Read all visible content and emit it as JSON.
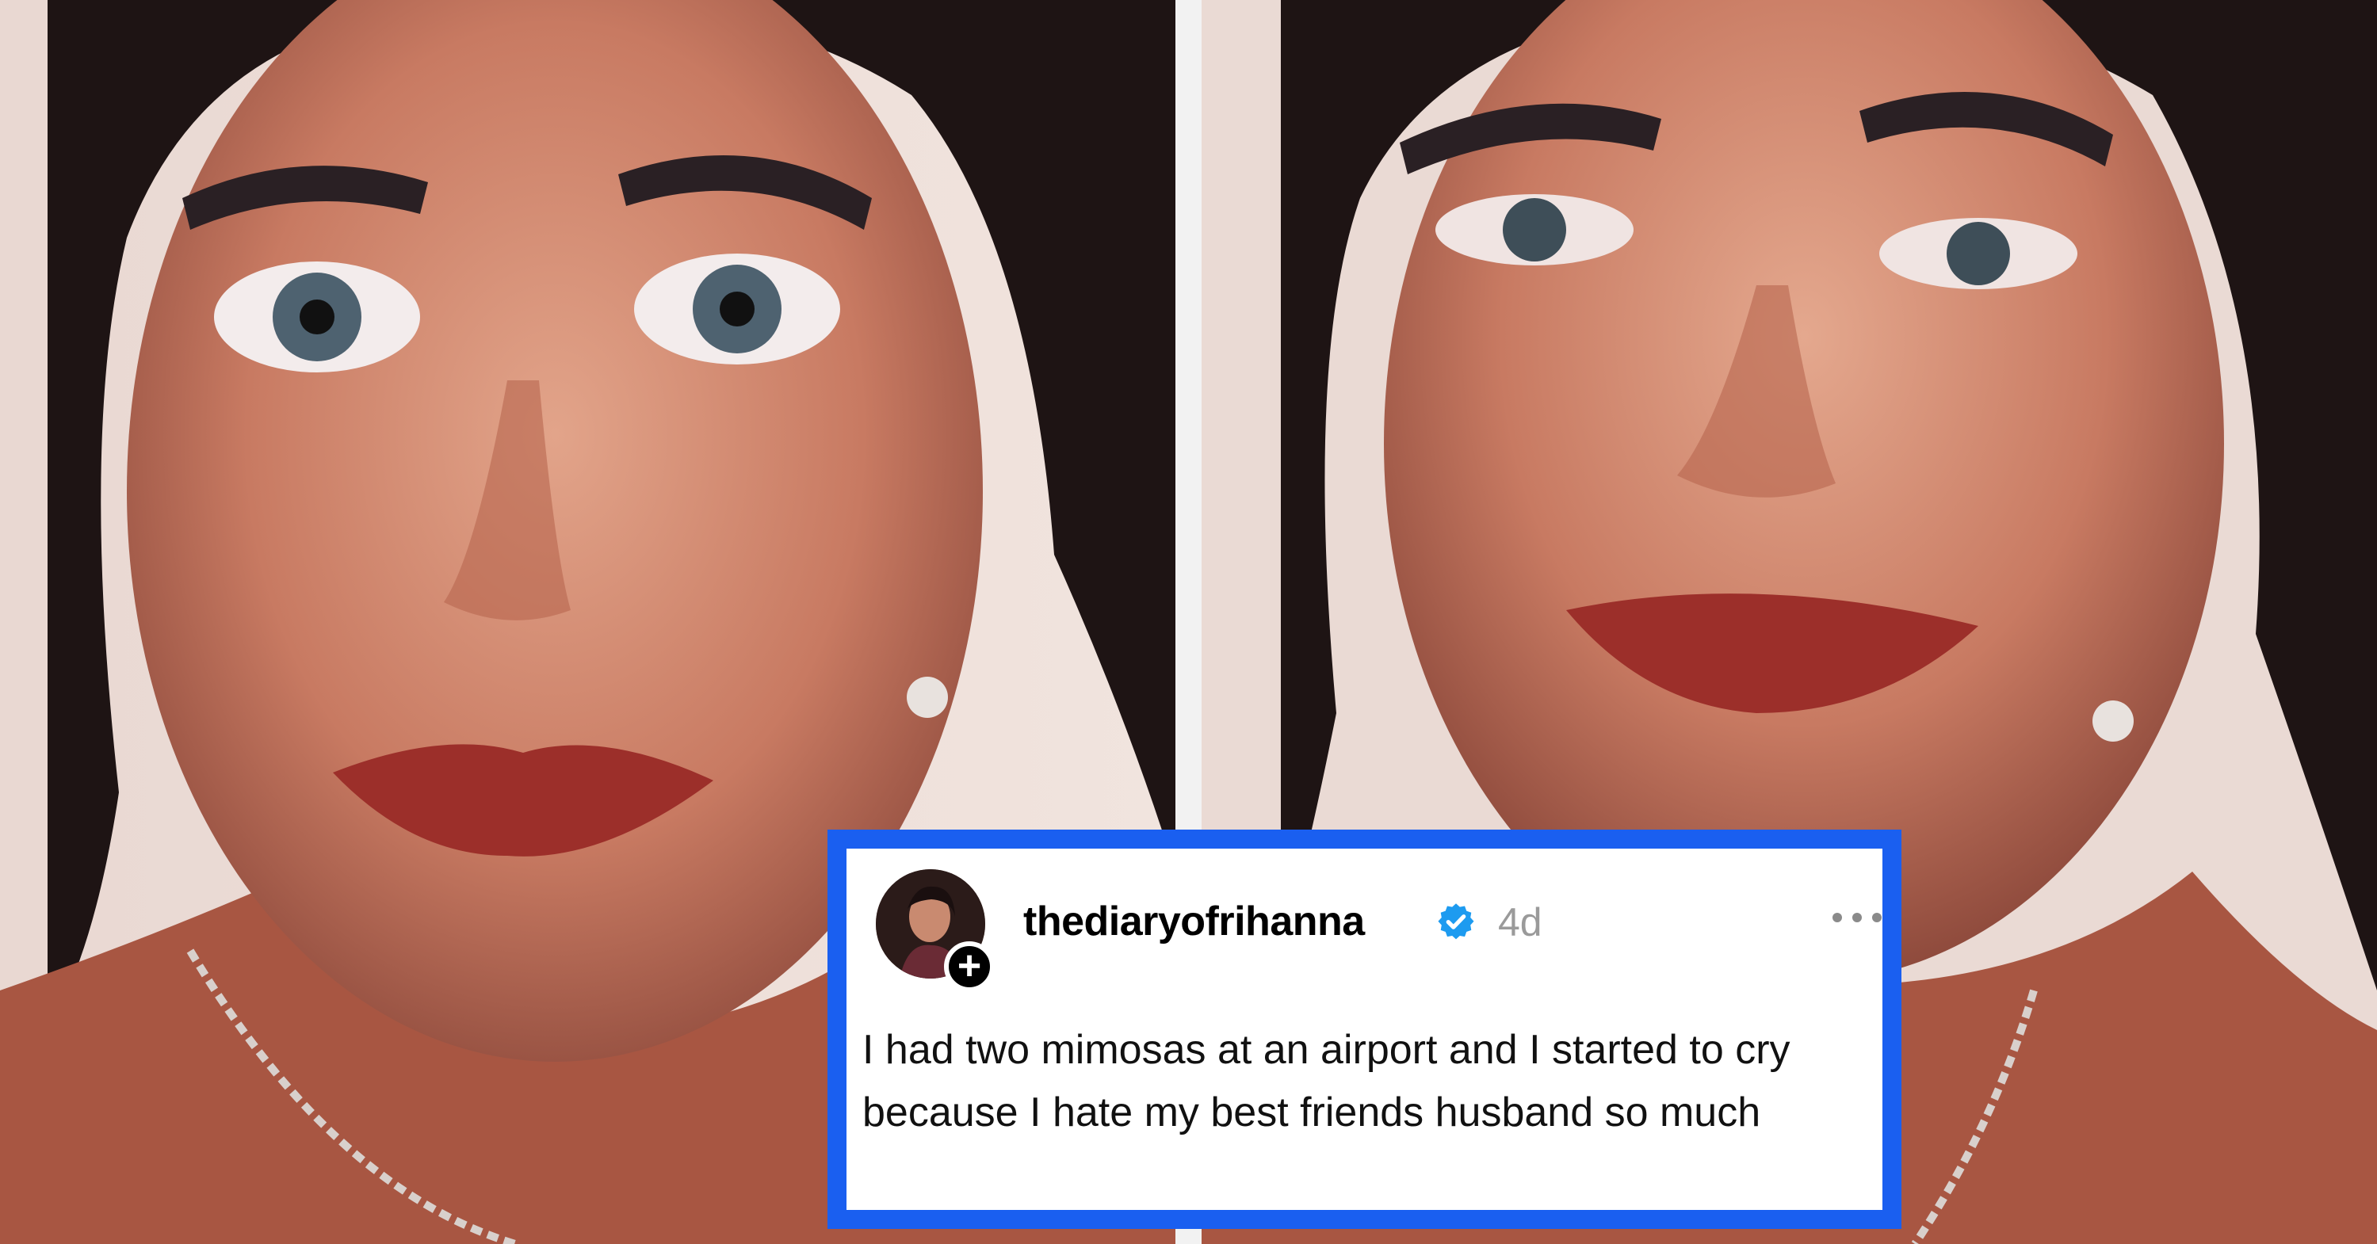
{
  "post": {
    "username": "thediaryofrihanna",
    "time": "4d",
    "text": "I had two mimosas at an airport and I started to cry because I hate my best friends husband so much",
    "follow_symbol": "+",
    "verified_icon": "verified-badge-icon",
    "more_icon": "more-options-icon"
  },
  "colors": {
    "card_border": "#1a5ff0",
    "verified": "#1d9bf0",
    "timestamp": "#9a9a9a"
  },
  "images": {
    "left": "woman-neutral-expression-photo",
    "right": "woman-tearful-smile-photo"
  }
}
